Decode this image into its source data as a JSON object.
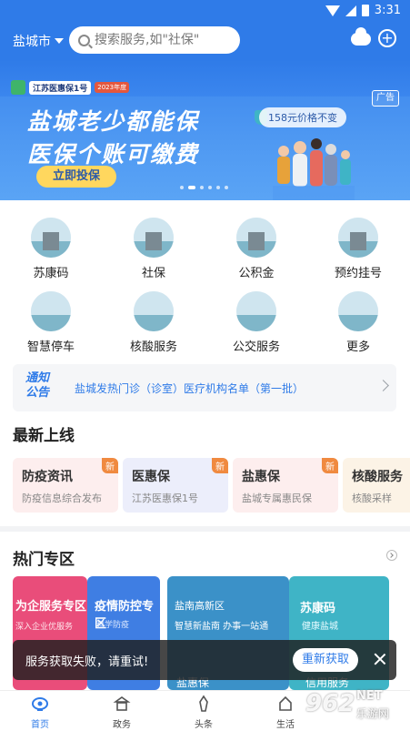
{
  "status_bar": {
    "time": "3:31"
  },
  "header": {
    "city": "盐城市",
    "search_placeholder": "搜索服务,如\"社保\""
  },
  "banner": {
    "logo_text": "江苏医惠保1号",
    "logo_year": "2023年度",
    "title_line1": "盐城老少都能保",
    "title_line2": "医保个账可缴费",
    "cta": "立即投保",
    "ad_label": "广告",
    "price_text": "158元价格不变",
    "slide_count": 6,
    "active_slide": 2
  },
  "services": [
    {
      "label": "苏康码",
      "icon": "sukangma-icon"
    },
    {
      "label": "社保",
      "icon": "social-security-icon"
    },
    {
      "label": "公积金",
      "icon": "housing-fund-icon"
    },
    {
      "label": "预约挂号",
      "icon": "appointment-icon"
    },
    {
      "label": "智慧停车",
      "icon": "parking-icon"
    },
    {
      "label": "核酸服务",
      "icon": "nucleic-test-icon"
    },
    {
      "label": "公交服务",
      "icon": "bus-icon"
    },
    {
      "label": "更多",
      "icon": "more-icon"
    }
  ],
  "notice": {
    "tag_line1": "通知",
    "tag_line2": "公告",
    "text": "盐城发热门诊（诊室）医疗机构名单（第一批）"
  },
  "latest": {
    "title": "最新上线",
    "cards": [
      {
        "title": "防疫资讯",
        "subtitle": "防疫信息综合发布",
        "badge": "新",
        "bg": "#fdeeee"
      },
      {
        "title": "医惠保",
        "subtitle": "江苏医惠保1号",
        "badge": "新",
        "bg": "#eceefb"
      },
      {
        "title": "盐惠保",
        "subtitle": "盐城专属惠民保",
        "badge": "新",
        "bg": "#fdeeee"
      },
      {
        "title": "核酸服务",
        "subtitle": "核酸采样",
        "badge": "",
        "bg": "#fcf3e6"
      }
    ]
  },
  "hot": {
    "title": "热门专区",
    "cards": [
      {
        "title": "为企服务专区",
        "subtitle": "深入企业优服务",
        "bg": "#e94d7a"
      },
      {
        "title": "疫情防控专区",
        "subtitle": "科学防疫",
        "bg": "#3f7ee3"
      },
      {
        "title": "盐南高新区",
        "subtitle": "智慧新盐南 办事一站通",
        "bg": "#3b91c8"
      },
      {
        "title": "苏康码",
        "subtitle": "健康盐城",
        "bg": "#3fb4c6"
      }
    ],
    "partial_labels": [
      "盐惠保",
      "信用服务"
    ]
  },
  "toast": {
    "text": "服务获取失败，请重试!",
    "button": "重新获取"
  },
  "bottom_nav": [
    {
      "label": "首页",
      "icon": "home-icon",
      "active": true
    },
    {
      "label": "政务",
      "icon": "government-icon",
      "active": false
    },
    {
      "label": "头条",
      "icon": "headline-icon",
      "active": false
    },
    {
      "label": "生活",
      "icon": "life-icon",
      "active": false
    }
  ],
  "watermark": {
    "text": "962",
    "subtext": "乐游网",
    "suffix": "NET"
  },
  "colors": {
    "primary": "#2f7be8",
    "badge": "#f08a40",
    "cta": "#ffd75e"
  }
}
